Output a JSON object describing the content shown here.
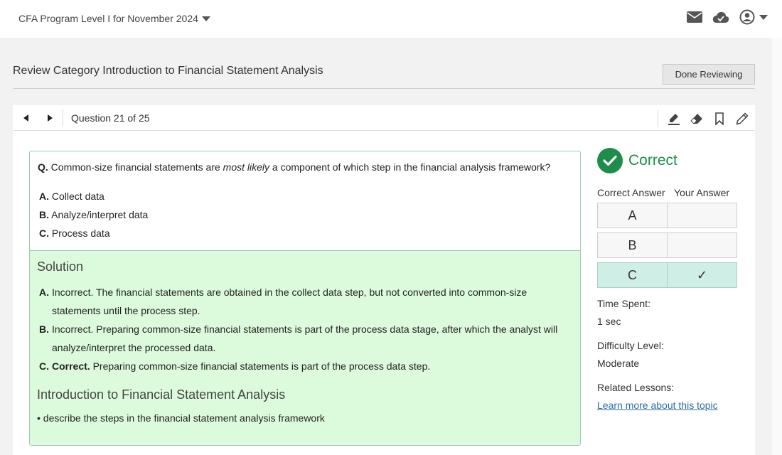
{
  "header": {
    "program": "CFA Program Level I for November 2024",
    "icons": [
      "envelope-icon",
      "cloud-check-icon",
      "user-circle-icon"
    ]
  },
  "review": {
    "title": "Review Category Introduction to Financial Statement Analysis",
    "done_label": "Done Reviewing"
  },
  "qnav": {
    "counter": "Question 21 of 25",
    "tools": [
      "highlighter-icon",
      "eraser-icon",
      "bookmark-icon",
      "pencil-icon"
    ]
  },
  "question": {
    "prefix": "Q.",
    "text_before": "Common-size financial statements are ",
    "text_emph": "most likely",
    "text_after": " a component of which step in the financial analysis framework?",
    "choices": [
      {
        "letter": "A.",
        "text": "Collect data"
      },
      {
        "letter": "B.",
        "text": "Analyze/interpret data"
      },
      {
        "letter": "C.",
        "text": "Process data"
      }
    ]
  },
  "solution": {
    "heading": "Solution",
    "items": [
      {
        "letter": "A.",
        "lead": "",
        "text": "Incorrect. The financial statements are obtained in the collect data step, but not converted into common-size statements until the process step."
      },
      {
        "letter": "B.",
        "lead": "",
        "text": "Incorrect. Preparing common-size financial statements is part of the process data stage, after which the analyst will analyze/interpret the processed data."
      },
      {
        "letter": "C.",
        "lead": "Correct.",
        "text": " Preparing common-size financial statements is part of the process data step."
      }
    ],
    "lesson_heading": "Introduction to Financial Statement Analysis",
    "lesson_item": "• describe the steps in the financial statement analysis framework"
  },
  "result": {
    "status": "Correct",
    "correct_answer_label": "Correct Answer",
    "your_answer_label": "Your Answer",
    "rows": [
      {
        "correct": "A",
        "yours": ""
      },
      {
        "correct": "B",
        "yours": ""
      },
      {
        "correct": "C",
        "yours": "✓"
      }
    ],
    "time_spent_label": "Time Spent:",
    "time_spent": "1 sec",
    "difficulty_label": "Difficulty Level:",
    "difficulty": "Moderate",
    "related_label": "Related Lessons:",
    "related_link": "Learn more about this topic"
  },
  "colors": {
    "accent_green": "#1e8d4a",
    "solution_bg": "#dcfadc",
    "highlight_row": "#cfeee6",
    "link": "#2c6ea6"
  }
}
